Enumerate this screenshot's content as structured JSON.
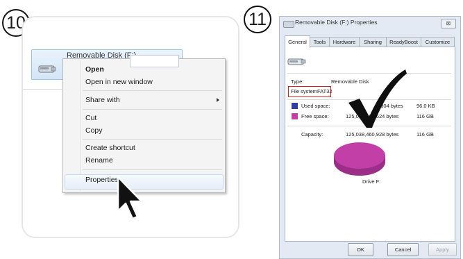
{
  "steps": {
    "left": "10",
    "right": "11"
  },
  "explorer": {
    "drive_label": "Removable Disk (F:)",
    "menu_items": [
      "Open",
      "Open in new window",
      "Share with",
      "Cut",
      "Copy",
      "Create shortcut",
      "Rename",
      "Properties"
    ]
  },
  "dialog": {
    "title": "Removable Disk (F:) Properties",
    "close": "⊠",
    "tabs": [
      "General",
      "Tools",
      "Hardware",
      "Sharing",
      "ReadyBoost",
      "Customize"
    ],
    "type_label": "Type:",
    "type_value": "Removable Disk",
    "fs_label": "File system:",
    "fs_value": "FAT32",
    "used_label": "Used space:",
    "used_bytes": "1,304 bytes",
    "used_size": "96.0 KB",
    "free_label": "Free space:",
    "free_bytes": "125,038,362,624 bytes",
    "free_size": "116 GB",
    "capacity_label": "Capacity:",
    "capacity_bytes": "125,038,460,928 bytes",
    "capacity_size": "116 GB",
    "drive_caption": "Drive F:",
    "buttons": {
      "ok": "OK",
      "cancel": "Cancel",
      "apply": "Apply"
    },
    "colors": {
      "used": "#2f3f9e",
      "free": "#c23fa8",
      "highlight_box": "#e11b1b"
    }
  }
}
